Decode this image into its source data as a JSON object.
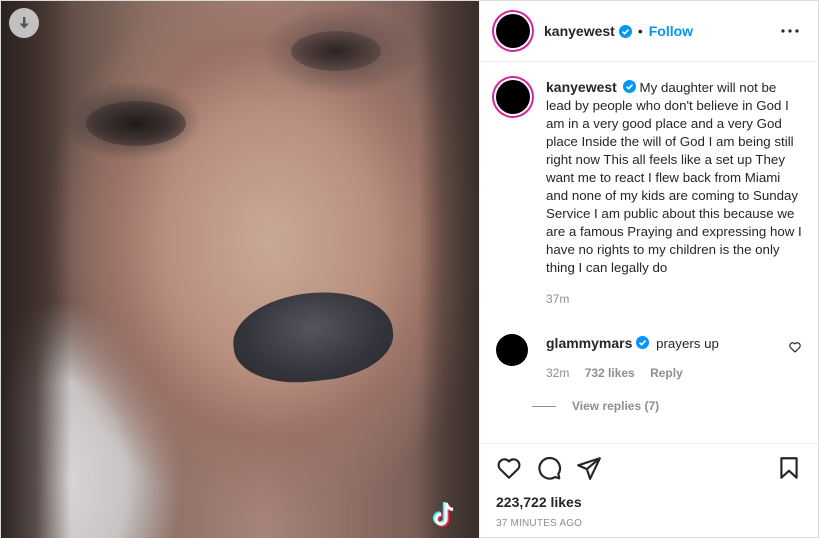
{
  "post": {
    "author": "kanyewest",
    "follow_label": "Follow",
    "separator": "•",
    "caption": "My daughter will not be lead by people who don't believe in God I am in a very good place and a very God place Inside the will of God I am being still right now This all feels like a set up They want me to react I flew back from Miami and none of my kids are coming to Sunday Service I am public about this because we are a famous Praying and expressing how I have no rights to my children is the only thing I can legally do",
    "caption_time": "37m",
    "likes": "223,722 likes",
    "posted_ago": "37 MINUTES AGO"
  },
  "comment": {
    "author": "glammymars",
    "text": "prayers up",
    "time": "32m",
    "likes": "732 likes",
    "reply_label": "Reply",
    "view_replies": "View replies (7)"
  },
  "icons": {
    "download": "download-arrow-icon",
    "verified": "verified-badge-icon",
    "more": "more-options-icon",
    "like": "heart-icon",
    "comment": "comment-icon",
    "share": "share-icon",
    "save": "bookmark-icon",
    "watermark": "tiktok-icon"
  },
  "colors": {
    "accent": "#0095f6",
    "text": "#262626",
    "muted": "#8e8e8e",
    "border": "#dbdbdb"
  }
}
